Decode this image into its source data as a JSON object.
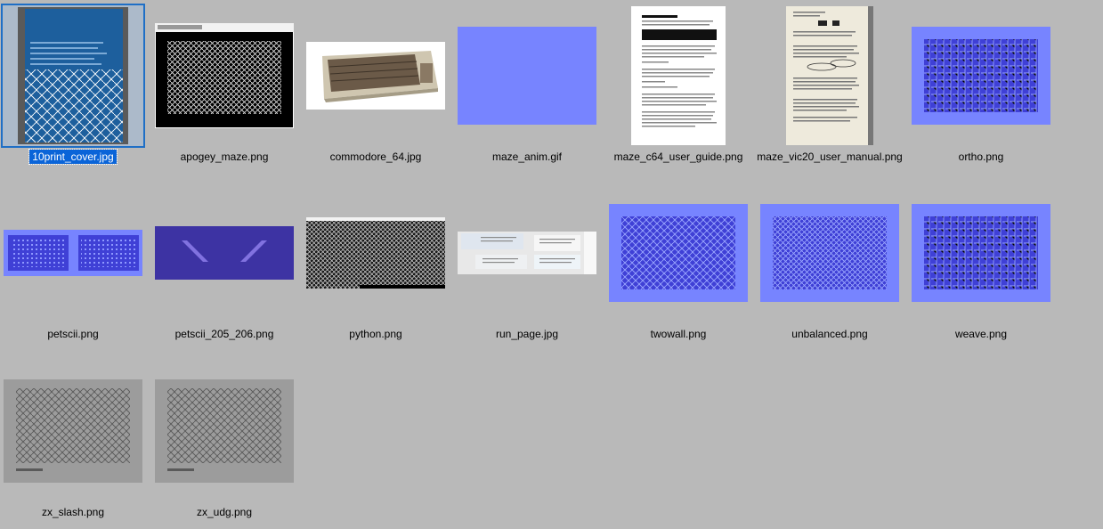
{
  "files": [
    {
      "name": "10print_cover.jpg",
      "selected": true,
      "thumb": "cover"
    },
    {
      "name": "apogey_maze.png",
      "selected": false,
      "thumb": "window-maze"
    },
    {
      "name": "commodore_64.jpg",
      "selected": false,
      "thumb": "c64"
    },
    {
      "name": "maze_anim.gif",
      "selected": false,
      "thumb": "blue-blank"
    },
    {
      "name": "maze_c64_user_guide.png",
      "selected": false,
      "thumb": "page-guide"
    },
    {
      "name": "maze_vic20_user_manual.png",
      "selected": false,
      "thumb": "page-manual"
    },
    {
      "name": "ortho.png",
      "selected": false,
      "thumb": "c64-maze-ortho"
    },
    {
      "name": "petscii.png",
      "selected": false,
      "thumb": "petscii"
    },
    {
      "name": "petscii_205_206.png",
      "selected": false,
      "thumb": "petscii-205"
    },
    {
      "name": "python.png",
      "selected": false,
      "thumb": "python"
    },
    {
      "name": "run_page.jpg",
      "selected": false,
      "thumb": "run-page"
    },
    {
      "name": "twowall.png",
      "selected": false,
      "thumb": "c64-maze-diag"
    },
    {
      "name": "unbalanced.png",
      "selected": false,
      "thumb": "c64-maze-diag2"
    },
    {
      "name": "weave.png",
      "selected": false,
      "thumb": "c64-maze-ortho"
    },
    {
      "name": "zx_slash.png",
      "selected": false,
      "thumb": "zx"
    },
    {
      "name": "zx_udg.png",
      "selected": false,
      "thumb": "zx"
    }
  ],
  "colors": {
    "background": "#b9b9b9",
    "selection": "#0a64d8",
    "c64_border": "#7f89ff",
    "c64_screen": "#3f3fd0",
    "zx_gray": "#9c9c9c"
  }
}
